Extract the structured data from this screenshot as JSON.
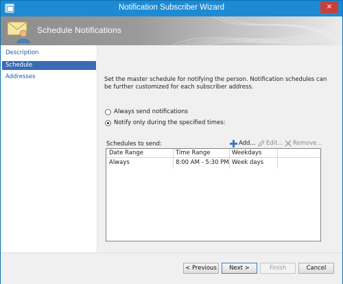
{
  "window": {
    "title": "Notification Subscriber Wizard",
    "close_glyph": "✕"
  },
  "banner": {
    "title": "Schedule Notifications",
    "icon": "envelope-person-icon"
  },
  "nav": {
    "items": [
      {
        "label": "Description"
      },
      {
        "label": "Schedule"
      },
      {
        "label": "Addresses"
      }
    ],
    "active": "Schedule"
  },
  "content": {
    "description": "Set the master schedule for notifying the person. Notification schedules can be further customized for each subscriber address.",
    "options": [
      {
        "label": "Always send notifications",
        "selected": false
      },
      {
        "label": "Notify only during the specified times:",
        "selected": true
      }
    ],
    "schedules_label": "Schedules to send:",
    "toolbar": {
      "add": "Add...",
      "edit": "Edit...",
      "remove": "Remove..."
    },
    "table": {
      "columns": [
        "Date Range",
        "Time Range",
        "Weekdays"
      ],
      "rows": [
        [
          "Always",
          "8:00 AM - 5:30 PM",
          "Week days"
        ]
      ]
    }
  },
  "footer": {
    "previous": "< Previous",
    "next": "Next >",
    "finish": "Finish",
    "cancel": "Cancel"
  },
  "colors": {
    "titlebar": "#1e8ad3",
    "nav_active": "#3a6cb4",
    "close": "#c9403a"
  }
}
